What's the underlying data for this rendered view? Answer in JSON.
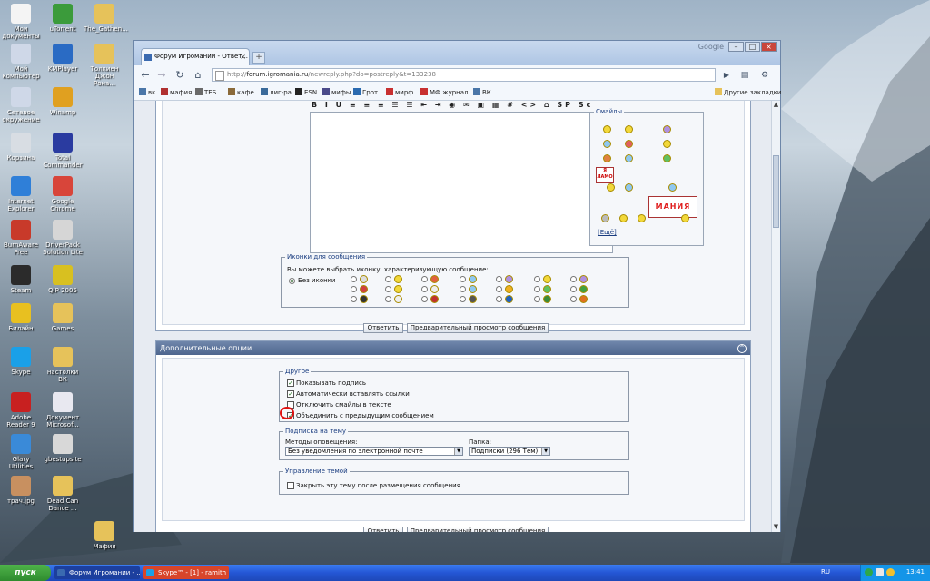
{
  "desktop": {
    "icons": [
      {
        "label": "Мои документы",
        "color": "#f4f4f4"
      },
      {
        "label": "uTorrent",
        "color": "#3b9b3b"
      },
      {
        "label": "The_Gathen...",
        "color": "#e6c25a"
      },
      {
        "label": "Мой компьютер",
        "color": "#cfd8e8"
      },
      {
        "label": "KMPlayer",
        "color": "#2a6bc4"
      },
      {
        "label": "Толкиен Джон Рона...",
        "color": "#e6c25a"
      },
      {
        "label": "Сетевое окружение",
        "color": "#cfd8e8"
      },
      {
        "label": "Winamp",
        "color": "#e0a020"
      },
      {
        "label": "Корзина",
        "color": "#d8dde3"
      },
      {
        "label": "Total Commander",
        "color": "#2a3ba0"
      },
      {
        "label": "Internet Explorer",
        "color": "#2f7fd8"
      },
      {
        "label": "Google Chrome",
        "color": "#d8453a"
      },
      {
        "label": "BurnAware Free",
        "color": "#c83a2a"
      },
      {
        "label": "DriverPack Solution Lite",
        "color": "#d6d6d6"
      },
      {
        "label": "Steam",
        "color": "#2b2b2b"
      },
      {
        "label": "QIP 2005",
        "color": "#d8c020"
      },
      {
        "label": "Билайн",
        "color": "#e8c020"
      },
      {
        "label": "Games",
        "color": "#e6c25a"
      },
      {
        "label": "Skype",
        "color": "#1aa0e8"
      },
      {
        "label": "настолки ВК",
        "color": "#e6c25a"
      },
      {
        "label": "Adobe Reader 9",
        "color": "#c82020"
      },
      {
        "label": "Документ Microsof...",
        "color": "#e8e8f0"
      },
      {
        "label": "Glary Utilities",
        "color": "#3a8ad8"
      },
      {
        "label": "gbestupsite",
        "color": "#d8d8d8"
      },
      {
        "label": "трач.jpg",
        "color": "#c89060"
      },
      {
        "label": "Dead Can Dance ...",
        "color": "#e6c25a"
      },
      {
        "label": "Мафия",
        "color": "#e6c25a"
      }
    ]
  },
  "browser": {
    "tab_title": "Форум Игромании - Ответ...",
    "google_label": "Google",
    "url_domain": "forum.igromania.ru",
    "url_prefix": "http://",
    "url_path": "/newreply.php?do=postreply&t=133238",
    "bookmarks": [
      {
        "label": "вк",
        "color": "#4a76a8"
      },
      {
        "label": "мафия",
        "color": "#b03030"
      },
      {
        "label": "TES",
        "color": "#6a6a6a"
      },
      {
        "label": "кафе",
        "color": "#8a6a3a"
      },
      {
        "label": "лиг-ра",
        "color": "#3a6a9a"
      },
      {
        "label": "ESN",
        "color": "#222222"
      },
      {
        "label": "мифы",
        "color": "#4a4a8a"
      },
      {
        "label": "Грот",
        "color": "#2a6ab0"
      },
      {
        "label": "мирф",
        "color": "#c83030"
      },
      {
        "label": "МФ журнал",
        "color": "#c83030"
      },
      {
        "label": "ВК",
        "color": "#4a76a8"
      }
    ],
    "other_bookmarks": "Другие закладки"
  },
  "page": {
    "toolbar_glyphs": "B I U ≡ ≡ ≡ ☰ ☰ ⇤ ⇥ ◉ ✉ ▣ ▦ # <> ⌂ SP Sc",
    "smilies_legend": "Смайлы",
    "smilies_more": "[Ещё]",
    "sign_text": "Я ЛАМО",
    "mania_text": "МАНИЯ",
    "post_icons": {
      "legend": "Иконки для сообщения",
      "description": "Вы можете выбрать иконку, характеризующую сообщение:",
      "no_icon": "Без иконки"
    },
    "submit_label": "Ответить",
    "preview_label": "Предварительный просмотр сообщения",
    "extra_header": "Дополнительные опции",
    "other": {
      "legend": "Другое",
      "show_signature": "Показывать подпись",
      "auto_links": "Автоматически вставлять ссылки",
      "disable_smilies": "Отключить смайлы в тексте",
      "merge_previous": "Объединить с предыдущим сообщением"
    },
    "subscribe": {
      "legend": "Подписка на тему",
      "method_label": "Методы оповещения:",
      "method_value": "Без уведомления по электронной почте",
      "folder_label": "Папка:",
      "folder_value": "Подписки (296 Тем)"
    },
    "thread": {
      "legend": "Управление темой",
      "close_after": "Закрыть эту тему после размещения сообщения"
    }
  },
  "taskbar": {
    "start_label": "пуск",
    "tasks": [
      {
        "label": "Форум Игромании - ...",
        "color": "#3a6ab0"
      },
      {
        "label": "Skype™ - [1] - ramith",
        "color": "#1aa0e8"
      }
    ],
    "lang": "RU",
    "clock": "13:41"
  },
  "colors": {
    "panel_header": "#4e668e",
    "highlight_circle": "#e01010"
  }
}
